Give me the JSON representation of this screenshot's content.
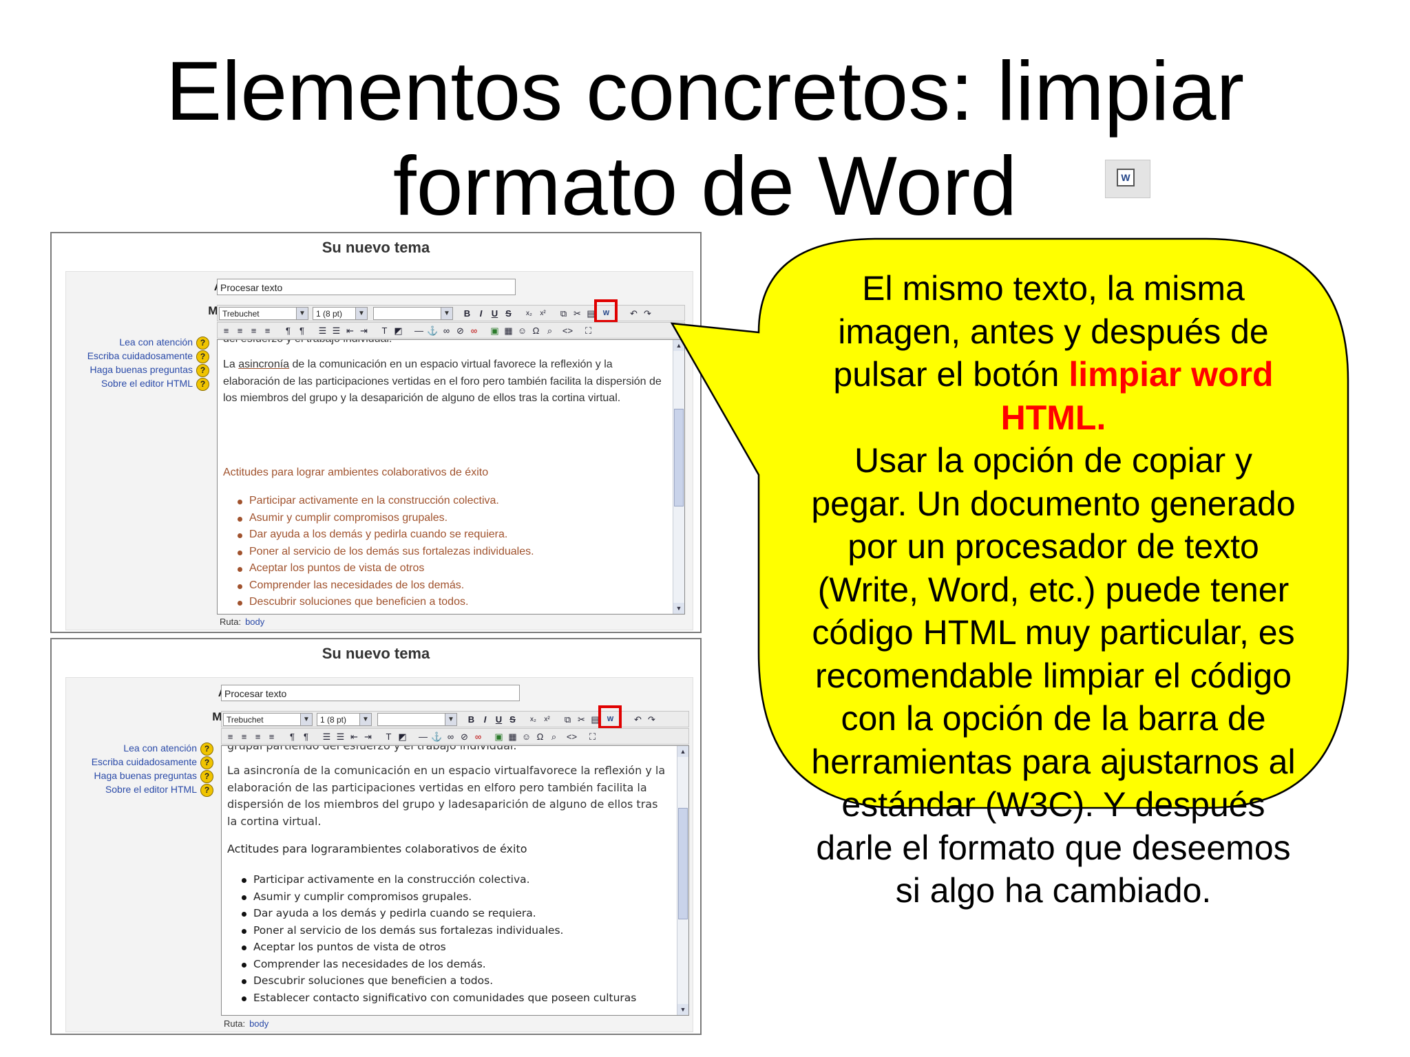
{
  "slide": {
    "title_line1": "Elementos concretos: limpiar",
    "title_line2": "formato de Word",
    "title_icon": "clean-word-html-icon"
  },
  "editor": {
    "panel_title": "Su nuevo tema",
    "asunto_label": "Asunto:",
    "asunto_value": "Procesar texto",
    "mensaje_label": "Mensaje:",
    "font_select": "Trebuchet",
    "size_select": "1 (8 pt)",
    "format_select": "",
    "side_links": [
      "Lea con atención",
      "Escriba cuidadosamente",
      "Haga buenas preguntas",
      "Sobre el editor HTML"
    ],
    "ruta_label": "Ruta:",
    "ruta_value": "body",
    "toolbar_icons": [
      "bold-icon",
      "italic-icon",
      "underline-icon",
      "strikethrough-icon",
      "subscript-icon",
      "superscript-icon",
      "copy-icon",
      "cut-icon",
      "paste-icon",
      "clean-word-html-icon",
      "undo-icon",
      "redo-icon"
    ],
    "colors": {
      "highlight_box": "#e00000",
      "link": "#2a4aa8",
      "word_text": "#a0522d"
    }
  },
  "before": {
    "cut_line": "del esfuerzo y el trabajo individual.",
    "para_parts": [
      "La ",
      "asincronía",
      " de la comunicación en un espacio virtual favorece la reflexión y la elaboración de las participaciones vertidas en el foro pero también facilita la dispersión de los miembros del grupo y la desaparición de alguno de ellos tras la cortina virtual."
    ],
    "heading": "Actitudes para lograr ambientes colaborativos de éxito",
    "items": [
      "Participar activamente en la construcción colectiva.",
      "Asumir y cumplir compromisos grupales.",
      "Dar ayuda a los demás y pedirla cuando se requiera.",
      "Poner al servicio de los demás sus fortalezas individuales.",
      "Aceptar los puntos de vista de otros",
      "Comprender las necesidades de los demás.",
      "Descubrir soluciones que beneficien a todos."
    ]
  },
  "after": {
    "cut_line": "grupal partiendo del esfuerzo y el trabajo individual.",
    "paragraph": "La asincronía de la comunicación en un espacio virtualfavorece la reflexión y la elaboración de las participaciones vertidas en elforo pero también facilita la dispersión de los miembros del grupo y ladesaparición de alguno de ellos tras la cortina virtual.",
    "heading": "Actitudes para lograrambientes colaborativos de éxito",
    "items": [
      "Participar activamente en la construcción colectiva.",
      "Asumir y cumplir compromisos grupales.",
      "Dar ayuda a los demás y pedirla cuando se requiera.",
      "Poner al servicio de los demás sus fortalezas individuales.",
      "Aceptar los puntos de vista de otros",
      "Comprender las necesidades de los demás.",
      "Descubrir soluciones que beneficien a todos.",
      "Establecer contacto significativo con comunidades que poseen culturas"
    ]
  },
  "callout": {
    "fill": "#ffff00",
    "line1": "El mismo texto, la misma",
    "line2": "imagen, antes y después de",
    "line3_pre": "pulsar el botón ",
    "line3_hl": "limpiar word",
    "line4_hl": "HTML.",
    "lines_rest": [
      "Usar la opción de copiar y",
      "pegar. Un documento generado",
      "por un procesador de texto",
      "(Write, Word, etc.) puede tener",
      "código HTML muy particular, es",
      "recomendable limpiar el código",
      "con la opción de la barra de",
      "herramientas para ajustarnos al",
      "estándar (W3C). Y después",
      "darle el formato que deseemos",
      "si algo ha cambiado."
    ]
  }
}
